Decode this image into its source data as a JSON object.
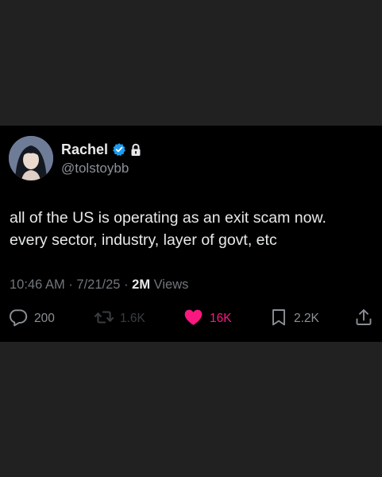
{
  "tweet": {
    "author": {
      "display_name": "Rachel",
      "handle": "@tolstoybb",
      "verified": true,
      "protected": true
    },
    "text_lines": [
      "all of the US is operating as an exit scam now.",
      "every sector, industry, layer of govt, etc"
    ],
    "meta": {
      "time": "10:46 AM",
      "separator": "·",
      "date": "7/21/25",
      "views_count": "2M",
      "views_label": "Views"
    },
    "actions": {
      "replies": "200",
      "reposts": "1.6K",
      "likes": "16K",
      "bookmarks": "2.2K"
    }
  },
  "colors": {
    "background": "#212121",
    "card": "#000000",
    "text": "#e7e9ea",
    "secondary": "#71767b",
    "verified": "#1d9bf0",
    "like": "#f91880"
  },
  "icons": [
    "verified-icon",
    "lock-icon",
    "reply-icon",
    "repost-icon",
    "heart-icon",
    "bookmark-icon",
    "share-icon"
  ]
}
